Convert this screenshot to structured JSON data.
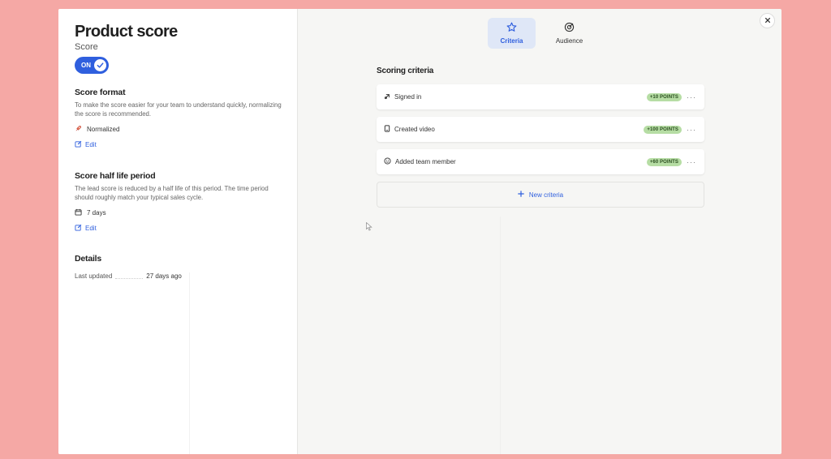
{
  "panel": {
    "title": "Product score",
    "subtitle": "Score",
    "toggle_label": "ON"
  },
  "score_format": {
    "title": "Score format",
    "description": "To make the score easier for your team to understand quickly, normalizing the score is recommended.",
    "value": "Normalized",
    "value_icon": "rocket-icon",
    "edit_label": "Edit"
  },
  "half_life": {
    "title": "Score half life period",
    "description": "The lead score is reduced by a half life of this period. The time period should roughly match your typical sales cycle.",
    "value": "7 days",
    "value_icon": "calendar-icon",
    "edit_label": "Edit"
  },
  "details": {
    "title": "Details",
    "last_updated_label": "Last updated",
    "last_updated_value": "27 days ago"
  },
  "tabs": [
    {
      "label": "Criteria",
      "icon": "star-icon",
      "active": true
    },
    {
      "label": "Audience",
      "icon": "target-icon",
      "active": false
    }
  ],
  "scoring": {
    "title": "Scoring criteria",
    "criteria": [
      {
        "label": "Signed in",
        "icon": "signin-icon",
        "points": "+10 POINTS"
      },
      {
        "label": "Created video",
        "icon": "video-icon",
        "points": "+100 POINTS"
      },
      {
        "label": "Added team member",
        "icon": "smile-icon",
        "points": "+60 POINTS"
      }
    ],
    "new_criteria_label": "New criteria"
  },
  "colors": {
    "background": "#f5a8a5",
    "accent": "#2f5fde",
    "badge": "#b6dda4"
  }
}
